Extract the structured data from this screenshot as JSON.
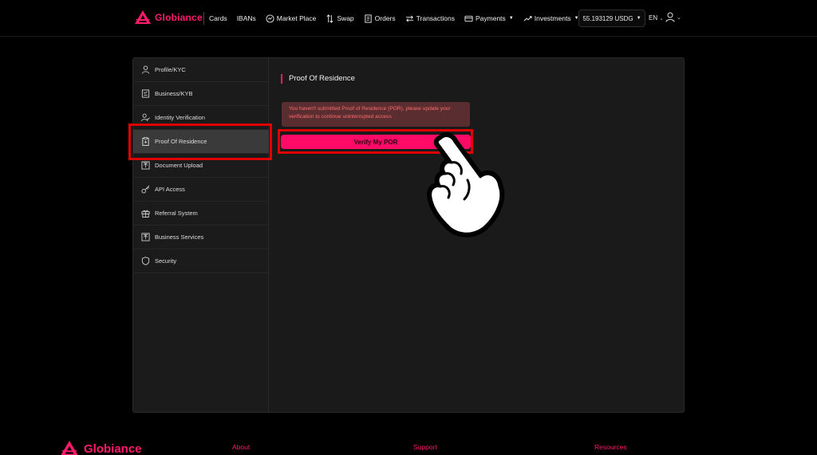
{
  "brand": {
    "name": "Globiance",
    "accent": "#ff1a6c"
  },
  "nav": {
    "items": [
      {
        "label": "Cards",
        "icon": "none"
      },
      {
        "label": "IBANs",
        "icon": "none"
      },
      {
        "label": "Market Place",
        "icon": "marketplace-icon"
      },
      {
        "label": "Swap",
        "icon": "swap-icon"
      },
      {
        "label": "Orders",
        "icon": "orders-icon"
      },
      {
        "label": "Transactions",
        "icon": "transactions-icon"
      },
      {
        "label": "Payments",
        "icon": "payments-icon",
        "dropdown": true
      },
      {
        "label": "Investments",
        "icon": "investments-icon",
        "dropdown": true
      }
    ],
    "balance": "55.193129 USDG",
    "language": "EN"
  },
  "sidebar": {
    "items": [
      {
        "label": "Profile/KYC",
        "icon": "user-icon"
      },
      {
        "label": "Business/KYB",
        "icon": "business-icon"
      },
      {
        "label": "Identity Verification",
        "icon": "identity-verification-icon"
      },
      {
        "label": "Proof Of Residence",
        "icon": "clipboard-icon",
        "active": true
      },
      {
        "label": "Document Upload",
        "icon": "upload-icon"
      },
      {
        "label": "API Access",
        "icon": "key-icon"
      },
      {
        "label": "Referral System",
        "icon": "gift-icon"
      },
      {
        "label": "Business Services",
        "icon": "business-services-icon"
      },
      {
        "label": "Security",
        "icon": "shield-icon"
      }
    ]
  },
  "main": {
    "title": "Proof Of Residence",
    "alert": "You haven't submitted Proof of Residence (POR), please update your verification to continue uninterrupted access",
    "verify_button": "Verify My POR"
  },
  "footer": {
    "brand": "Globiance",
    "links": [
      "About",
      "Support",
      "Resources"
    ]
  },
  "colors": {
    "button": "#ff0a66",
    "alert_bg": "#5a2d30",
    "alert_text": "#ff6b6b",
    "highlight": "#e00000"
  }
}
